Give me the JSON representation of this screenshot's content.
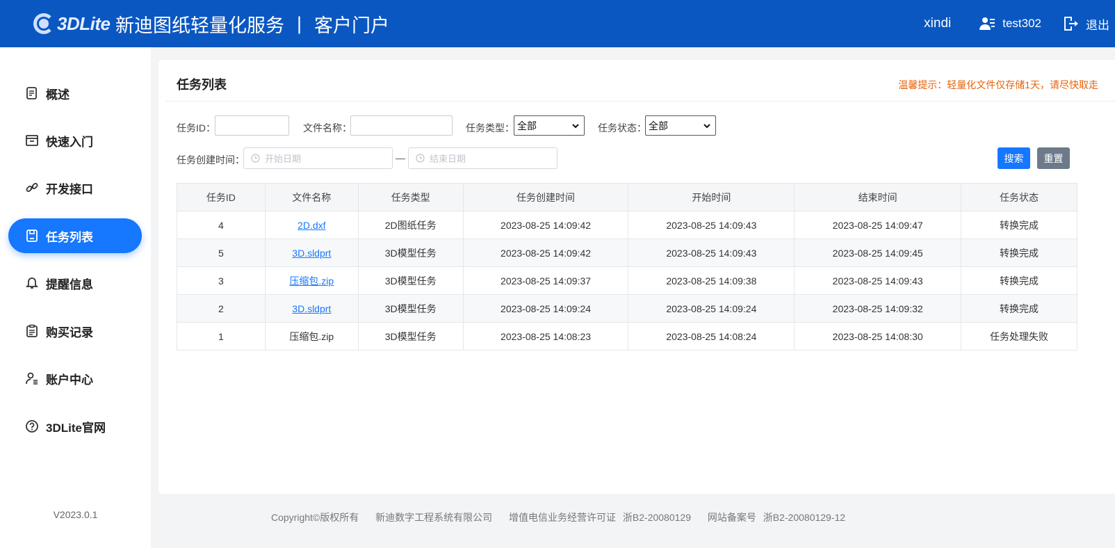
{
  "header": {
    "logo_text": "3DLite",
    "title": "新迪图纸轻量化服务",
    "separator": "|",
    "subtitle": "客户门户",
    "username": "xindi",
    "account": "test302",
    "logout": "退出"
  },
  "sidebar": {
    "items": [
      {
        "label": "概述",
        "icon": "document-icon"
      },
      {
        "label": "快速入门",
        "icon": "box-icon"
      },
      {
        "label": "开发接口",
        "icon": "link-icon"
      },
      {
        "label": "任务列表",
        "icon": "save-icon",
        "active": true
      },
      {
        "label": "提醒信息",
        "icon": "bell-icon"
      },
      {
        "label": "购买记录",
        "icon": "clipboard-icon"
      },
      {
        "label": "账户中心",
        "icon": "user-icon"
      },
      {
        "label": "3DLite官网",
        "icon": "help-icon"
      }
    ],
    "version": "V2023.0.1"
  },
  "main": {
    "title": "任务列表",
    "tip": "温馨提示：轻量化文件仅存储1天，请尽快取走",
    "filters": {
      "task_id_label": "任务ID：",
      "task_id_value": "",
      "file_name_label": "文件名称：",
      "file_name_value": "",
      "task_type_label": "任务类型：",
      "task_type_value": "全部",
      "task_status_label": "任务状态：",
      "task_status_value": "全部",
      "create_time_label": "任务创建时间：",
      "start_placeholder": "开始日期",
      "range_separator": "—",
      "end_placeholder": "结束日期",
      "search_label": "搜索",
      "reset_label": "重置"
    },
    "table": {
      "columns": [
        "任务ID",
        "文件名称",
        "任务类型",
        "任务创建时间",
        "开始时间",
        "结束时间",
        "任务状态"
      ],
      "rows": [
        {
          "id": "4",
          "file": "2D.dxf",
          "link": true,
          "type": "2D图纸任务",
          "created": "2023-08-25 14:09:42",
          "start": "2023-08-25 14:09:43",
          "end": "2023-08-25 14:09:47",
          "status": "转换完成"
        },
        {
          "id": "5",
          "file": "3D.sldprt",
          "link": true,
          "type": "3D模型任务",
          "created": "2023-08-25 14:09:42",
          "start": "2023-08-25 14:09:43",
          "end": "2023-08-25 14:09:45",
          "status": "转换完成"
        },
        {
          "id": "3",
          "file": "压缩包.zip",
          "link": true,
          "type": "3D模型任务",
          "created": "2023-08-25 14:09:37",
          "start": "2023-08-25 14:09:38",
          "end": "2023-08-25 14:09:43",
          "status": "转换完成"
        },
        {
          "id": "2",
          "file": "3D.sldprt",
          "link": true,
          "type": "3D模型任务",
          "created": "2023-08-25 14:09:24",
          "start": "2023-08-25 14:09:24",
          "end": "2023-08-25 14:09:32",
          "status": "转换完成"
        },
        {
          "id": "1",
          "file": "压缩包.zip",
          "link": false,
          "type": "3D模型任务",
          "created": "2023-08-25 14:08:23",
          "start": "2023-08-25 14:08:24",
          "end": "2023-08-25 14:08:30",
          "status": "任务处理失败"
        }
      ]
    }
  },
  "footer": {
    "copyright": "Copyright©版权所有",
    "company": "新迪数字工程系统有限公司",
    "license_label": "增值电信业务经营许可证",
    "license_no": "浙B2-20080129",
    "icp_label": "网站备案号",
    "icp_no": "浙B2-20080129-12"
  },
  "colors": {
    "header_bg": "#0a57c2",
    "accent": "#1677ff",
    "tip": "#e8630a",
    "reset_button": "#6c7a89"
  }
}
